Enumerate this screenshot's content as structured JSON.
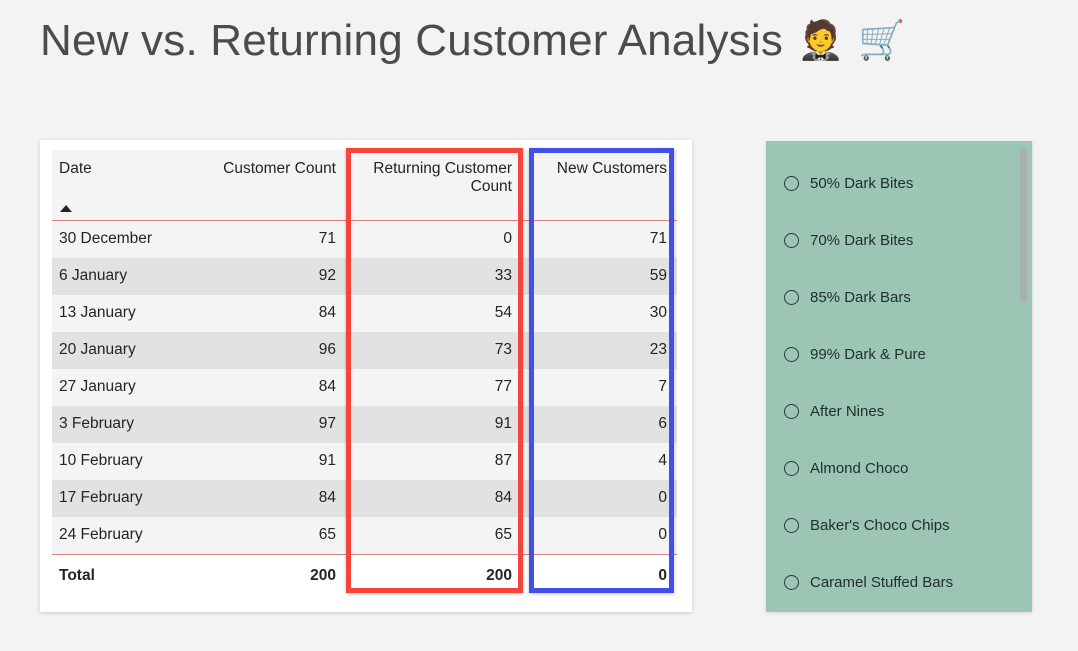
{
  "header": {
    "title": "New vs. Returning Customer Analysis",
    "emoji_person": "🤵",
    "emoji_cart": "🛒",
    "emoji_person_name": "person-in-tuxedo-emoji",
    "emoji_cart_name": "shopping-cart-emoji"
  },
  "table": {
    "columns": [
      {
        "label": "Date",
        "align": "left"
      },
      {
        "label": "Customer Count",
        "align": "right"
      },
      {
        "label": "Returning Customer Count",
        "align": "right"
      },
      {
        "label": "New Customers",
        "align": "right"
      }
    ],
    "sort_column": "Date",
    "sort_direction": "ascending",
    "rows": [
      {
        "date": "30 December",
        "customer_count": "71",
        "returning_customer_count": "0",
        "new_customers": "71"
      },
      {
        "date": "6 January",
        "customer_count": "92",
        "returning_customer_count": "33",
        "new_customers": "59"
      },
      {
        "date": "13 January",
        "customer_count": "84",
        "returning_customer_count": "54",
        "new_customers": "30"
      },
      {
        "date": "20 January",
        "customer_count": "96",
        "returning_customer_count": "73",
        "new_customers": "23"
      },
      {
        "date": "27 January",
        "customer_count": "84",
        "returning_customer_count": "77",
        "new_customers": "7"
      },
      {
        "date": "3 February",
        "customer_count": "97",
        "returning_customer_count": "91",
        "new_customers": "6"
      },
      {
        "date": "10 February",
        "customer_count": "91",
        "returning_customer_count": "87",
        "new_customers": "4"
      },
      {
        "date": "17 February",
        "customer_count": "84",
        "returning_customer_count": "84",
        "new_customers": "0"
      },
      {
        "date": "24 February",
        "customer_count": "65",
        "returning_customer_count": "65",
        "new_customers": "0"
      }
    ],
    "total": {
      "label": "Total",
      "customer_count": "200",
      "returning_customer_count": "200",
      "new_customers": "0"
    }
  },
  "highlights": [
    {
      "name": "returning-customer-count-column",
      "color": "#f4443c"
    },
    {
      "name": "new-customers-column",
      "color": "#4250e8"
    }
  ],
  "slicer": {
    "background_color": "#9cc6b3",
    "items": [
      {
        "label": "50% Dark Bites",
        "selected": false
      },
      {
        "label": "70% Dark Bites",
        "selected": false
      },
      {
        "label": "85% Dark Bars",
        "selected": false
      },
      {
        "label": "99% Dark & Pure",
        "selected": false
      },
      {
        "label": "After Nines",
        "selected": false
      },
      {
        "label": "Almond Choco",
        "selected": false
      },
      {
        "label": "Baker's Choco Chips",
        "selected": false
      },
      {
        "label": "Caramel Stuffed Bars",
        "selected": false
      }
    ]
  },
  "colors": {
    "page_background": "#f3f3f3",
    "card_background": "#ffffff",
    "row_odd": "#f4f4f4",
    "row_even": "#e2e2e2",
    "header_rule": "#d9827e",
    "text": "#252423",
    "highlight_red": "#f4443c",
    "highlight_blue": "#4250e8",
    "slicer_green": "#9cc6b3"
  }
}
